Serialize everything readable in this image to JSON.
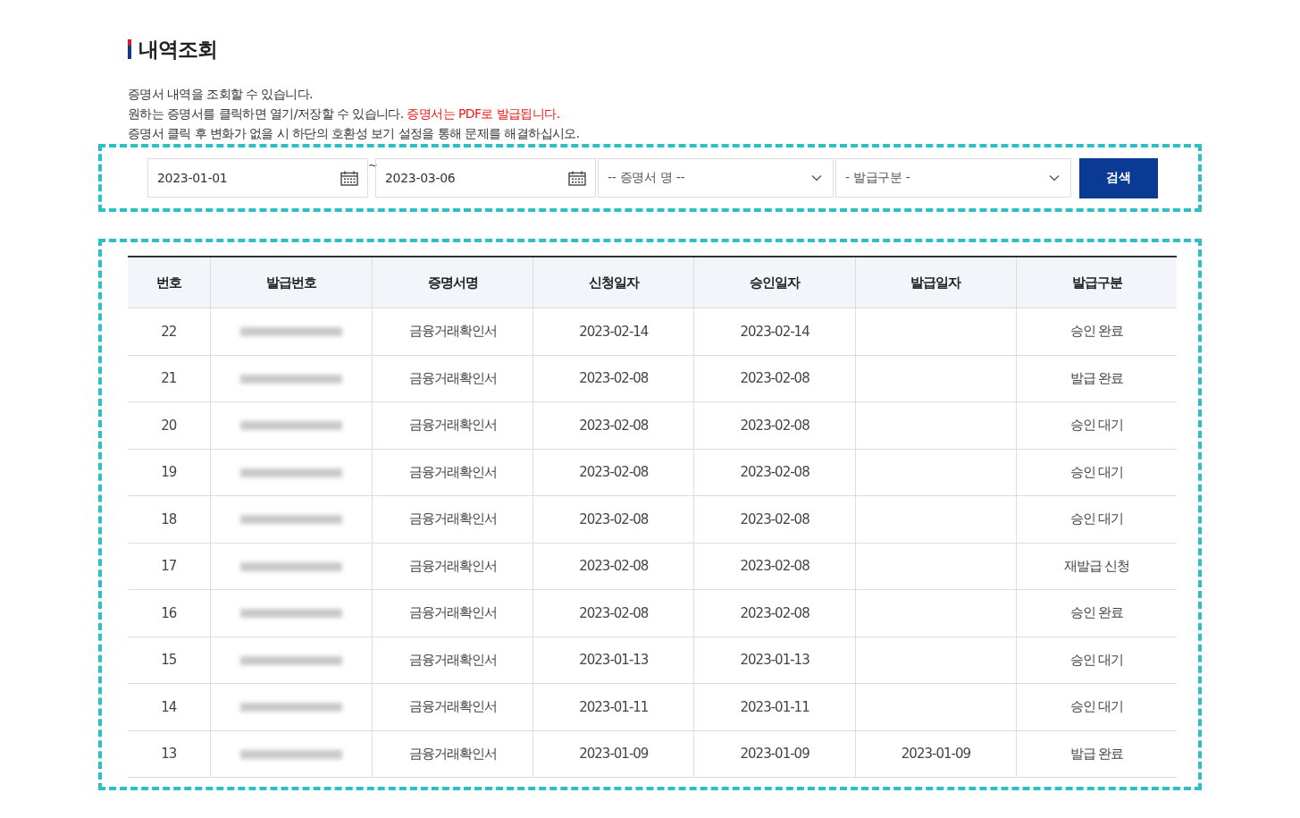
{
  "title": "내역조회",
  "description": [
    [
      {
        "text": "증명서 내역을 조회할 수 있습니다.",
        "emphasis": false
      }
    ],
    [
      {
        "text": "원하는 증명서를 클릭하면 열기/저장할 수 있습니다. ",
        "emphasis": false
      },
      {
        "text": "증명서는 PDF로 발급됩니다.",
        "emphasis": true
      }
    ],
    [
      {
        "text": "증명서 클릭 후 변화가 없을 시 하단의 호환성 보기 설정을 통해 문제를 해결하십시오.",
        "emphasis": false
      }
    ]
  ],
  "search": {
    "start_date": "2023-01-01",
    "separator": "~",
    "end_date": "2023-03-06",
    "certificate_select": "-- 증명서 명 --",
    "issue_type_select": "- 발급구분 -",
    "button": "검색"
  },
  "table": {
    "columns": [
      "번호",
      "발급번호",
      "증명서명",
      "신청일자",
      "승인일자",
      "발급일자",
      "발급구분"
    ],
    "rows": [
      {
        "no": "22",
        "name": "금융거래확인서",
        "applied": "2023-02-14",
        "approved": "2023-02-14",
        "issued": "",
        "status": "승인 완료"
      },
      {
        "no": "21",
        "name": "금융거래확인서",
        "applied": "2023-02-08",
        "approved": "2023-02-08",
        "issued": "",
        "status": "발급 완료"
      },
      {
        "no": "20",
        "name": "금융거래확인서",
        "applied": "2023-02-08",
        "approved": "2023-02-08",
        "issued": "",
        "status": "승인 대기"
      },
      {
        "no": "19",
        "name": "금융거래확인서",
        "applied": "2023-02-08",
        "approved": "2023-02-08",
        "issued": "",
        "status": "승인 대기"
      },
      {
        "no": "18",
        "name": "금융거래확인서",
        "applied": "2023-02-08",
        "approved": "2023-02-08",
        "issued": "",
        "status": "승인 대기"
      },
      {
        "no": "17",
        "name": "금융거래확인서",
        "applied": "2023-02-08",
        "approved": "2023-02-08",
        "issued": "",
        "status": "재발급 신청"
      },
      {
        "no": "16",
        "name": "금융거래확인서",
        "applied": "2023-02-08",
        "approved": "2023-02-08",
        "issued": "",
        "status": "승인 완료"
      },
      {
        "no": "15",
        "name": "금융거래확인서",
        "applied": "2023-01-13",
        "approved": "2023-01-13",
        "issued": "",
        "status": "승인 대기"
      },
      {
        "no": "14",
        "name": "금융거래확인서",
        "applied": "2023-01-11",
        "approved": "2023-01-11",
        "issued": "",
        "status": "승인 대기"
      },
      {
        "no": "13",
        "name": "금융거래확인서",
        "applied": "2023-01-09",
        "approved": "2023-01-09",
        "issued": "2023-01-09",
        "status": "발급 완료"
      }
    ]
  }
}
